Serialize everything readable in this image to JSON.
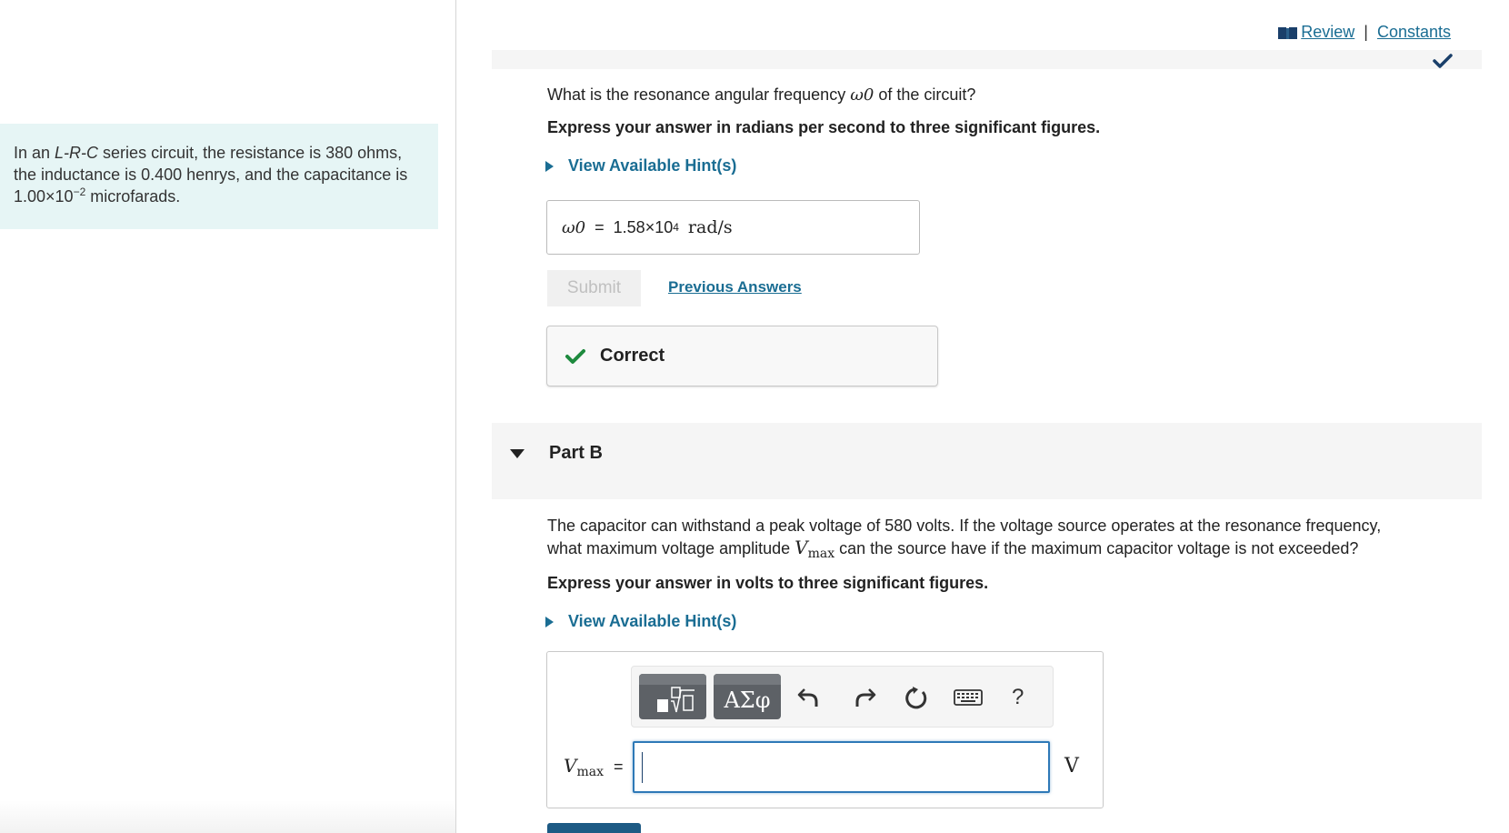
{
  "intro": {
    "prefix": "In an ",
    "circuit_type": "L-R-C",
    "text1": " series circuit, the resistance is 380 ohms, the inductance is 0.400 henrys, and the capacitance is 1.00×10",
    "exponent": "−2",
    "text2": " microfarads."
  },
  "top_links": {
    "review": "Review",
    "separator": "|",
    "constants": "Constants"
  },
  "part_a": {
    "question_prefix": "What is the resonance angular frequency ",
    "omega": "ω0",
    "question_suffix": " of the circuit?",
    "instruction": "Express your answer in radians per second to three significant figures.",
    "hint_label": "View Available Hint(s)",
    "answer": {
      "variable": "ω0",
      "equals": "=",
      "mantissa": "1.58×10",
      "exponent": "4",
      "unit": "rad/s"
    },
    "submit_label": "Submit",
    "previous_answers_label": "Previous Answers",
    "feedback": "Correct"
  },
  "part_b": {
    "title": "Part B",
    "question_line1": "The capacitor can withstand a peak voltage of 580 volts. If the voltage source operates at the resonance frequency,",
    "question_line2_prefix": "what maximum voltage amplitude ",
    "vmax_var": "V",
    "vmax_sub": "max",
    "question_line2_suffix": " can the source have if the maximum capacitor voltage is not exceeded?",
    "instruction": "Express your answer in volts to three significant figures.",
    "hint_label": "View Available Hint(s)",
    "toolbar": {
      "symbols_label": "ΑΣφ",
      "help_label": "?"
    },
    "input": {
      "label_var": "V",
      "label_sub": "max",
      "equals": "=",
      "value": "",
      "unit": "V"
    }
  },
  "colors": {
    "link": "#1a6d93",
    "intro_bg": "#e6f5f5",
    "correct_green": "#1e8a3e",
    "active_border": "#2e79b7"
  }
}
